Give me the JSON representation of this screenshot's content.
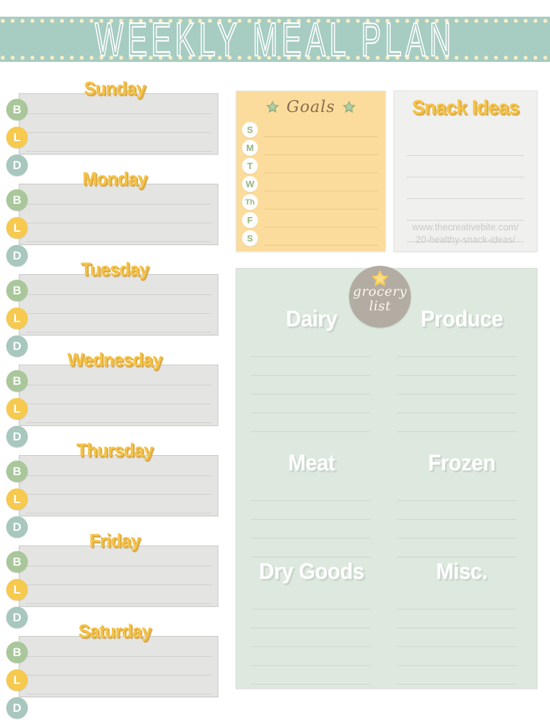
{
  "header": {
    "title": "WEEKLY MEAL PLAN"
  },
  "days": {
    "meal_labels": {
      "breakfast": "B",
      "lunch": "L",
      "dinner": "D"
    },
    "items": [
      {
        "name": "Sunday"
      },
      {
        "name": "Monday"
      },
      {
        "name": "Tuesday"
      },
      {
        "name": "Wednesday"
      },
      {
        "name": "Thursday"
      },
      {
        "name": "Friday"
      },
      {
        "name": "Saturday"
      }
    ]
  },
  "goals": {
    "title": "Goals",
    "star_icon": "star-icon",
    "rows": [
      {
        "label": "S"
      },
      {
        "label": "M"
      },
      {
        "label": "T"
      },
      {
        "label": "W"
      },
      {
        "label": "Th"
      },
      {
        "label": "F"
      },
      {
        "label": "S"
      }
    ]
  },
  "snack_ideas": {
    "title": "Snack Ideas",
    "line_count": 5,
    "url_line1": "www.thecreativebite.com/",
    "url_line2": "20-healthy-snack-ideas/"
  },
  "grocery": {
    "badge": {
      "line1": "grocery",
      "line2": "list",
      "star_icon": "star-icon"
    },
    "sections": [
      {
        "title": "Dairy",
        "lines": 5
      },
      {
        "title": "Produce",
        "lines": 5
      },
      {
        "title": "Meat",
        "lines": 4
      },
      {
        "title": "Frozen",
        "lines": 4
      },
      {
        "title": "Dry Goods",
        "lines": 5
      },
      {
        "title": "Misc.",
        "lines": 5
      }
    ]
  },
  "colors": {
    "banner_mint": "#a7ccc2",
    "banner_dots_cream": "#f6eec6",
    "day_title_gold": "#f5c349",
    "day_card_gray": "#e4e4e2",
    "breakfast_green": "#a9c79b",
    "lunch_yellow": "#f6c94f",
    "dinner_teal": "#a8c7be",
    "goals_yellow": "#fbdc9c",
    "goals_script_brown": "#8a6c4e",
    "snack_gray": "#f0f0ee",
    "grocery_green": "#dde8df",
    "badge_taupe": "#b3aca2",
    "star_green": "#93b583"
  }
}
